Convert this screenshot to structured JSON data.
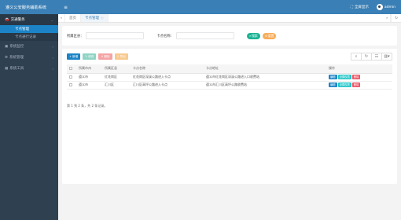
{
  "app": {
    "title": "遵义公安服务辅助系统"
  },
  "sidebar": {
    "groups": [
      {
        "label": "交通警务",
        "active": true,
        "items": [
          {
            "label": "卡点管理",
            "active": true
          },
          {
            "label": "卡点通行记录",
            "active": false
          }
        ]
      },
      {
        "label": "系统监控",
        "active": false,
        "items": []
      },
      {
        "label": "系统管理",
        "active": false,
        "items": []
      },
      {
        "label": "系统工具",
        "active": false,
        "items": []
      }
    ]
  },
  "topbar": {
    "fullscreen": "全屏显示",
    "user": "admin"
  },
  "tabs": {
    "home": "首页",
    "current": "卡点管理"
  },
  "search": {
    "area_label": "所属区县：",
    "area_value": "",
    "name_label": "卡点名称：",
    "name_value": "",
    "search_btn": "搜索",
    "reset_btn": "重置"
  },
  "toolbar": {
    "add": "新增",
    "edit": "修改",
    "delete": "删除",
    "export": "导出"
  },
  "table": {
    "headers": [
      "所属市州",
      "所属区县",
      "卡点名称",
      "卡点地址",
      "操作"
    ],
    "rows": [
      {
        "city": "遵义市",
        "district": "红花岗区",
        "name": "红花岗区深溪公路进入卡点",
        "address": "遵义市红花岗区深溪公路进入口收费站"
      },
      {
        "city": "遵义市",
        "district": "汇川区",
        "name": "汇川区高坪公路进入卡点",
        "address": "遵义市汇川区高坪公路收费站"
      }
    ],
    "ops": {
      "edit": "编辑",
      "set": "设置权限",
      "delete": "删除"
    }
  },
  "pager": {
    "text": "第 1 到 2 条，共 2 条记录。"
  },
  "colors": {
    "topbar": "#3a7fb5",
    "sidebar": "#2f4050",
    "primary": "#1c84c6",
    "success": "#1ab394",
    "warning": "#f8ac59",
    "danger": "#ed5565"
  }
}
